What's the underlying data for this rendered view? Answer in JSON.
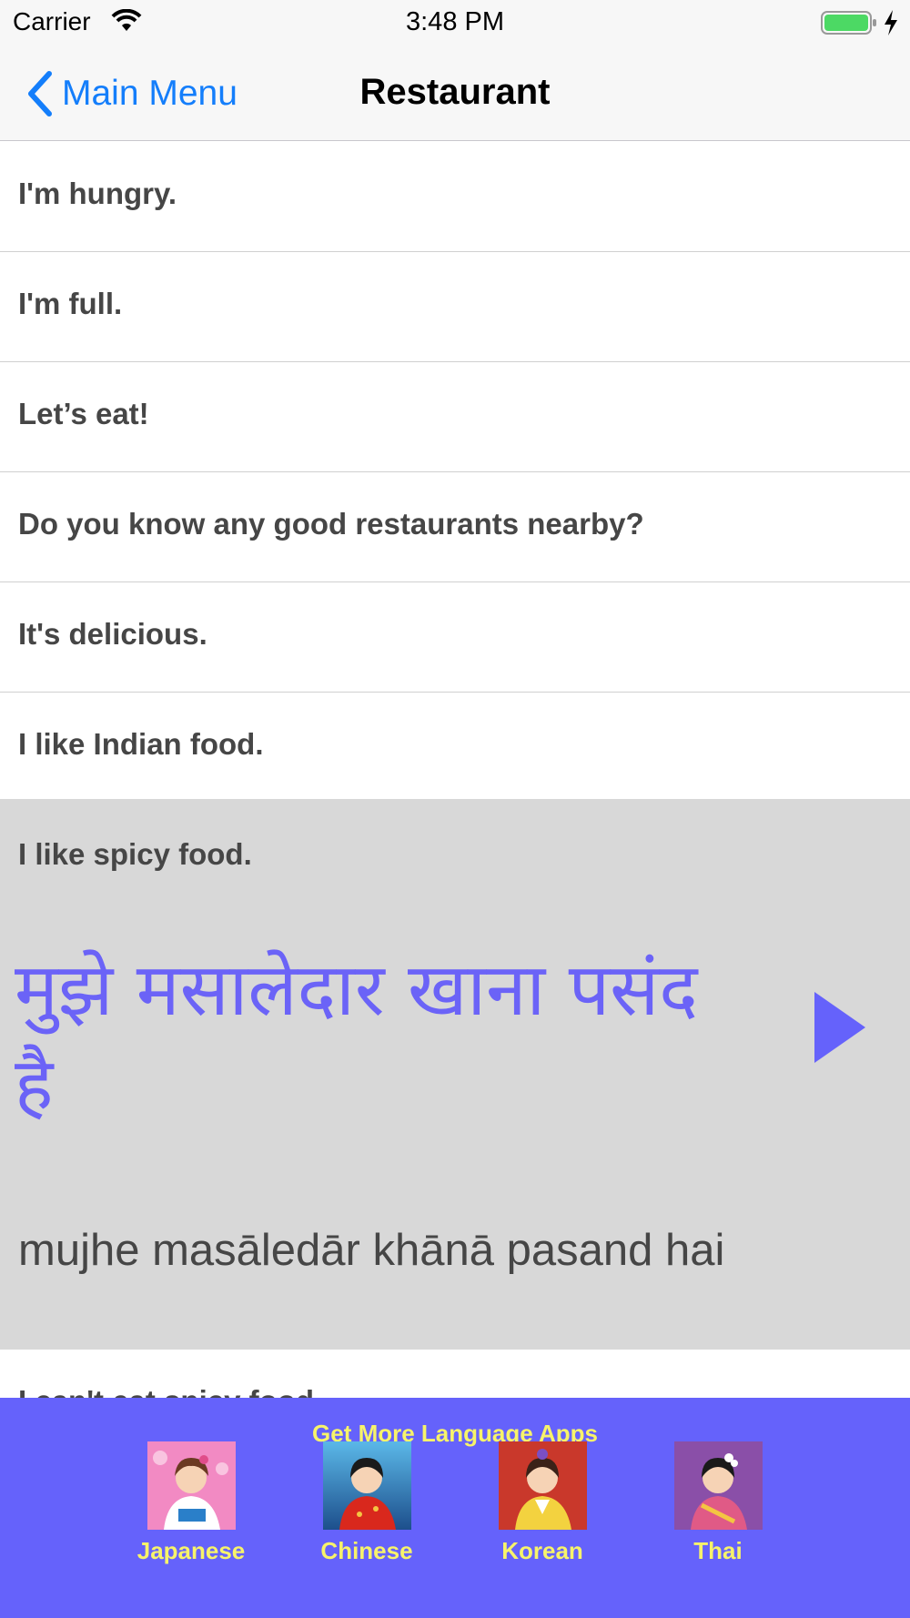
{
  "status_bar": {
    "carrier": "Carrier",
    "time": "3:48 PM"
  },
  "nav": {
    "back_label": "Main Menu",
    "title": "Restaurant"
  },
  "phrases": [
    {
      "english": "I'm hungry."
    },
    {
      "english": "I'm full."
    },
    {
      "english": "Let’s eat!"
    },
    {
      "english": "Do you know any good restaurants nearby?"
    },
    {
      "english": "It's delicious."
    },
    {
      "english": "I like Indian food."
    }
  ],
  "expanded": {
    "english": "I like spicy food.",
    "hindi": "मुझे मसालेदार खाना पसंद है",
    "romanization": "mujhe masāledār khānā pasand hai"
  },
  "partial_row": {
    "english": "I can't eat spicy food."
  },
  "promo": {
    "title": "Get More Language Apps",
    "apps": [
      {
        "label": "Japanese"
      },
      {
        "label": "Chinese"
      },
      {
        "label": "Korean"
      },
      {
        "label": "Thai"
      }
    ]
  },
  "colors": {
    "accent": "#147efb",
    "hindi_text": "#6b63f7",
    "expanded_bg": "#d8d8d8",
    "promo_bg": "#6562fb",
    "promo_text": "#f7f36a",
    "battery": "#4cd964"
  },
  "icons": {
    "back": "chevron-left-icon",
    "play": "play-icon",
    "wifi": "wifi-icon",
    "battery": "battery-icon",
    "charging": "lightning-icon"
  }
}
